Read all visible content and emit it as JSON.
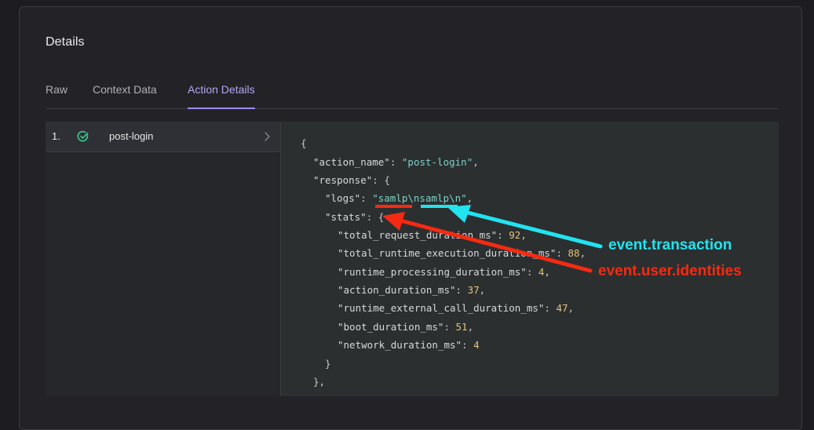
{
  "details": {
    "title": "Details",
    "tabs": [
      {
        "label": "Raw",
        "active": false
      },
      {
        "label": "Context Data",
        "active": false
      },
      {
        "label": "Action Details",
        "active": true
      }
    ]
  },
  "actions": [
    {
      "number": "1.",
      "name": "post-login",
      "status": "success",
      "icon": "check-circle-icon"
    }
  ],
  "code": {
    "open_brace": "{",
    "action_name_key": "\"action_name\"",
    "action_name_value": "\"post-login\"",
    "response_key": "\"response\"",
    "logs_key": "\"logs\"",
    "logs_value": "\"samlp\\nsamlp\\n\"",
    "stats_key": "\"stats\"",
    "stats": [
      {
        "key": "\"total_request_duration_ms\"",
        "value": "92",
        "comma": ","
      },
      {
        "key": "\"total_runtime_execution_duration_ms\"",
        "value": "88",
        "comma": ","
      },
      {
        "key": "\"runtime_processing_duration_ms\"",
        "value": "4",
        "comma": ","
      },
      {
        "key": "\"action_duration_ms\"",
        "value": "37",
        "comma": ","
      },
      {
        "key": "\"runtime_external_call_duration_ms\"",
        "value": "47",
        "comma": ","
      },
      {
        "key": "\"boot_duration_ms\"",
        "value": "51",
        "comma": ","
      },
      {
        "key": "\"network_duration_ms\"",
        "value": "4",
        "comma": ""
      }
    ],
    "close_stats": "}",
    "close_response": "},"
  },
  "annotations": {
    "transaction": {
      "label": "event.transaction",
      "color": "#22e3f0"
    },
    "identities": {
      "label": "event.user.identities",
      "color": "#f52a12"
    }
  },
  "colors": {
    "accent": "#9f8bf0",
    "success": "#3ccf91",
    "string": "#7fd1c7",
    "number": "#e3c47a"
  }
}
